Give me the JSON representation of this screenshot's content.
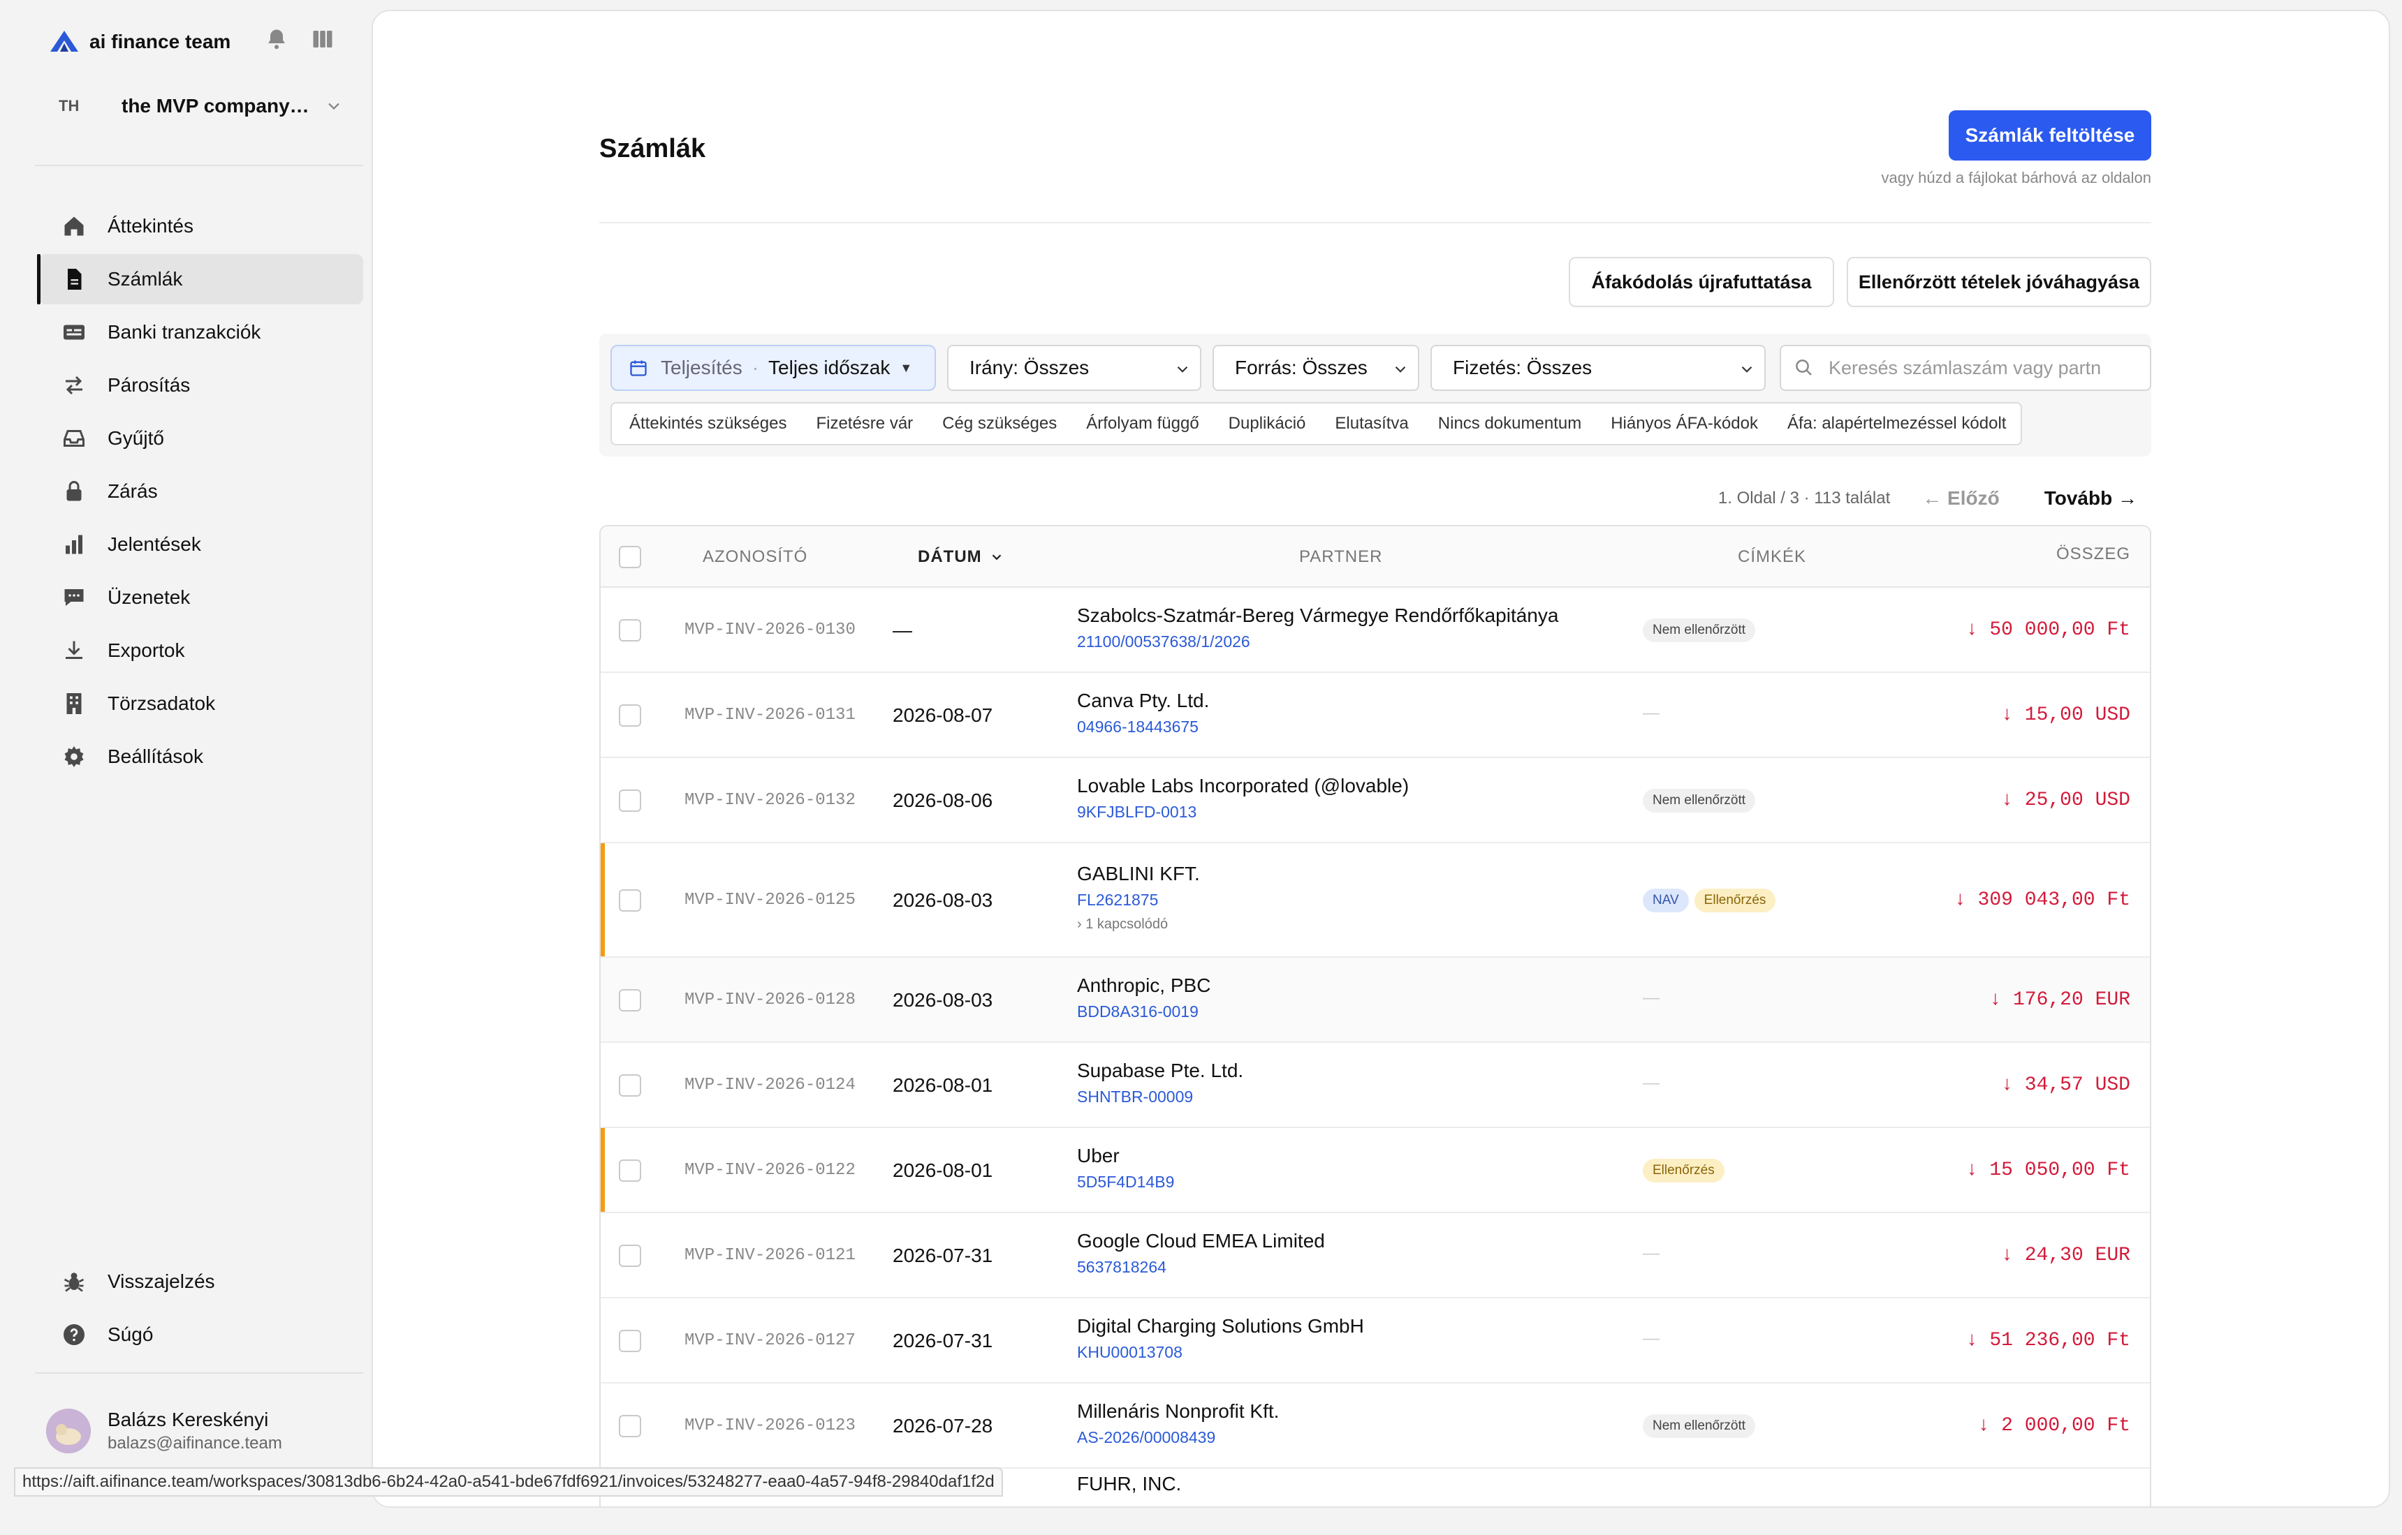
{
  "brand": {
    "name": "ai finance team",
    "icon": "logo-icon"
  },
  "workspace": {
    "initials": "TH",
    "name": "the MVP company…"
  },
  "nav": {
    "items": [
      {
        "label": "Áttekintés",
        "icon": "home-icon"
      },
      {
        "label": "Számlák",
        "icon": "document-icon",
        "active": true
      },
      {
        "label": "Banki tranzakciók",
        "icon": "bank-card-icon"
      },
      {
        "label": "Párosítás",
        "icon": "swap-arrows-icon"
      },
      {
        "label": "Gyűjtő",
        "icon": "inbox-tray-icon"
      },
      {
        "label": "Zárás",
        "icon": "lock-icon"
      },
      {
        "label": "Jelentések",
        "icon": "bar-chart-icon"
      },
      {
        "label": "Üzenetek",
        "icon": "chat-bubble-icon"
      },
      {
        "label": "Exportok",
        "icon": "download-icon"
      },
      {
        "label": "Törzsadatok",
        "icon": "building-icon"
      },
      {
        "label": "Beállítások",
        "icon": "gear-icon"
      }
    ],
    "bottom": [
      {
        "label": "Visszajelzés",
        "icon": "bug-icon"
      },
      {
        "label": "Súgó",
        "icon": "help-icon"
      }
    ]
  },
  "user": {
    "name": "Balázs Kereskényi",
    "email": "balazs@aifinance.team"
  },
  "page": {
    "title": "Számlák",
    "upload_label": "Számlák feltöltése",
    "upload_hint": "vagy húzd a fájlokat bárhová az oldalon",
    "rerun_label": "Áfakódolás újrafuttatása",
    "approve_label": "Ellenőrzött tételek jóváhagyása"
  },
  "filters": {
    "period_label": "Teljesítés",
    "period_sep": "·",
    "period_value": "Teljes időszak",
    "direction": "Irány: Összes",
    "source": "Forrás: Összes",
    "payment": "Fizetés: Összes",
    "search_placeholder": "Keresés számlaszám vagy partn",
    "chips": [
      "Áttekintés szükséges",
      "Fizetésre vár",
      "Cég szükséges",
      "Árfolyam függő",
      "Duplikáció",
      "Elutasítva",
      "Nincs dokumentum",
      "Hiányos ÁFA-kódok",
      "Áfa: alapértelmezéssel kódolt"
    ]
  },
  "pager": {
    "info": "1. Oldal / 3 · 113 találat",
    "prev": "← Előző",
    "next": "Tovább →"
  },
  "table": {
    "headers": {
      "id": "AZONOSÍTÓ",
      "date": "DÁTUM",
      "partner": "PARTNER",
      "tags": "CÍMKÉK",
      "amount": "ÖSSZEG"
    },
    "rows": [
      {
        "id": "MVP-INV-2026-0130",
        "date": "—",
        "partner": "Szabolcs-Szatmár-Bereg Vármegye Rendőrfőkapitánya",
        "ref": "21100/00537638/1/2026",
        "tags": [
          "Nem ellenőrzött"
        ],
        "amount": "↓ 50 000,00 Ft"
      },
      {
        "id": "MVP-INV-2026-0131",
        "date": "2026-08-07",
        "partner": "Canva Pty. Ltd.",
        "ref": "04966-18443675",
        "tags": [],
        "amount": "↓ 15,00 USD"
      },
      {
        "id": "MVP-INV-2026-0132",
        "date": "2026-08-06",
        "partner": "Lovable Labs Incorporated (@lovable)",
        "ref": "9KFJBLFD-0013",
        "tags": [
          "Nem ellenőrzött"
        ],
        "amount": "↓ 25,00 USD"
      },
      {
        "id": "MVP-INV-2026-0125",
        "date": "2026-08-03",
        "partner": "GABLINI KFT.",
        "ref": "FL2621875",
        "related": "› 1 kapcsolódó",
        "tags": [
          "NAV",
          "Ellenőrzés"
        ],
        "amount": "↓ 309 043,00 Ft",
        "flag": true
      },
      {
        "id": "MVP-INV-2026-0128",
        "date": "2026-08-03",
        "partner": "Anthropic, PBC",
        "ref": "BDD8A316-0019",
        "tags": [],
        "amount": "↓ 176,20 EUR",
        "hover": true
      },
      {
        "id": "MVP-INV-2026-0124",
        "date": "2026-08-01",
        "partner": "Supabase Pte. Ltd.",
        "ref": "SHNTBR-00009",
        "tags": [],
        "amount": "↓ 34,57 USD"
      },
      {
        "id": "MVP-INV-2026-0122",
        "date": "2026-08-01",
        "partner": "Uber",
        "ref": "5D5F4D14B9",
        "tags": [
          "Ellenőrzés"
        ],
        "amount": "↓ 15 050,00 Ft",
        "flag": true
      },
      {
        "id": "MVP-INV-2026-0121",
        "date": "2026-07-31",
        "partner": "Google Cloud EMEA Limited",
        "ref": "5637818264",
        "tags": [],
        "amount": "↓ 24,30 EUR"
      },
      {
        "id": "MVP-INV-2026-0127",
        "date": "2026-07-31",
        "partner": "Digital Charging Solutions GmbH",
        "ref": "KHU00013708",
        "tags": [],
        "amount": "↓ 51 236,00 Ft"
      },
      {
        "id": "MVP-INV-2026-0123",
        "date": "2026-07-28",
        "partner": "Millenáris Nonprofit Kft.",
        "ref": "AS-2026/00008439",
        "tags": [
          "Nem ellenőrzött"
        ],
        "amount": "↓ 2 000,00 Ft"
      },
      {
        "id": "",
        "date": "",
        "partner": "FUHR, INC.",
        "ref": "",
        "tags": [],
        "amount": ""
      }
    ]
  },
  "statusbar": {
    "url": "https://aift.aifinance.team/workspaces/30813db6-6b24-42a0-a541-bde67fdf6921/invoices/53248277-eaa0-4a57-94f8-29840daf1f2d"
  },
  "colors": {
    "accent": "#2b5af0",
    "amount_negative": "#d31a3a",
    "flag": "#f39c12",
    "link": "#2b5ad8"
  }
}
